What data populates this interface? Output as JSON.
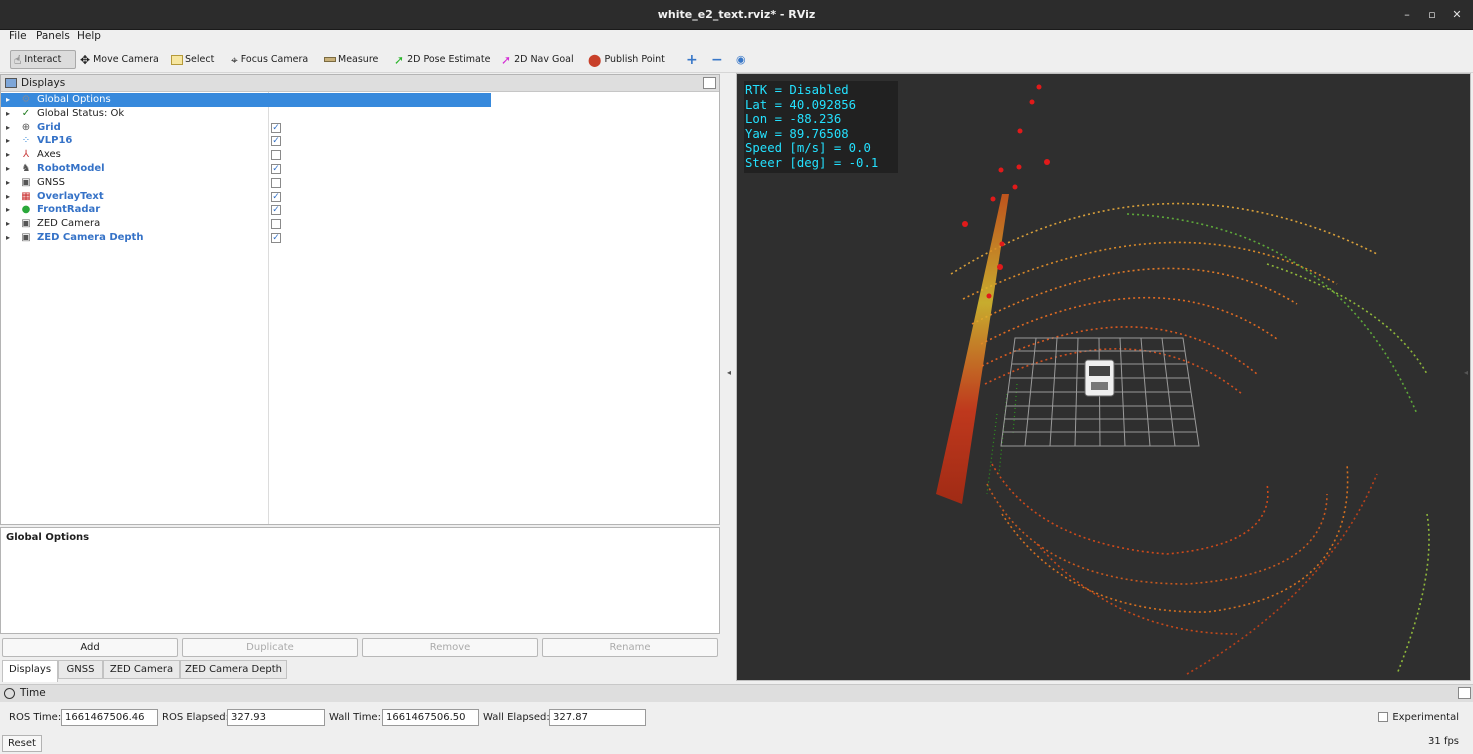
{
  "window": {
    "title": "white_e2_text.rviz* - RViz",
    "min": "–",
    "max": "▫",
    "close": "✕"
  },
  "menu": [
    "File",
    "Panels",
    "Help"
  ],
  "toolbar": {
    "interact": "Interact",
    "move_camera": "Move Camera",
    "select": "Select",
    "focus_camera": "Focus Camera",
    "measure": "Measure",
    "pose_estimate": "2D Pose Estimate",
    "nav_goal": "2D Nav Goal",
    "publish_point": "Publish Point",
    "add_tool": "+",
    "remove_tool": "−",
    "view_menu": "◉"
  },
  "displays_panel": {
    "title": "Displays",
    "items": [
      {
        "label": "Global Options",
        "bold": false,
        "checkbox": null,
        "icon": "gear-icon",
        "glyph": "⚙"
      },
      {
        "label": "Global Status: Ok",
        "bold": false,
        "checkbox": null,
        "icon": "check-icon",
        "glyph": "✓"
      },
      {
        "label": "Grid",
        "bold": true,
        "checkbox": true,
        "icon": "grid-icon",
        "glyph": "⊕"
      },
      {
        "label": "VLP16",
        "bold": true,
        "checkbox": true,
        "icon": "pointcloud-icon",
        "glyph": "⁘"
      },
      {
        "label": "Axes",
        "bold": false,
        "checkbox": false,
        "icon": "axes-icon",
        "glyph": "⅄"
      },
      {
        "label": "RobotModel",
        "bold": true,
        "checkbox": true,
        "icon": "robot-icon",
        "glyph": "♞"
      },
      {
        "label": "GNSS",
        "bold": false,
        "checkbox": false,
        "icon": "image-icon",
        "glyph": "▣"
      },
      {
        "label": "OverlayText",
        "bold": true,
        "checkbox": true,
        "icon": "overlay-icon",
        "glyph": "▦"
      },
      {
        "label": "FrontRadar",
        "bold": true,
        "checkbox": true,
        "icon": "markers-icon",
        "glyph": "●"
      },
      {
        "label": "ZED Camera",
        "bold": false,
        "checkbox": false,
        "icon": "image-icon",
        "glyph": "▣"
      },
      {
        "label": "ZED Camera Depth",
        "bold": true,
        "checkbox": true,
        "icon": "image-icon",
        "glyph": "▣"
      }
    ]
  },
  "properties": {
    "title": "Global Options"
  },
  "buttons": {
    "add": "Add",
    "duplicate": "Duplicate",
    "remove": "Remove",
    "rename": "Rename"
  },
  "tabs": [
    "Displays",
    "GNSS",
    "ZED Camera",
    "ZED Camera Depth"
  ],
  "overlay_text": [
    "RTK = Disabled",
    "Lat = 40.092856",
    "Lon = -88.236",
    "Yaw = 89.76508",
    "Speed [m/s] = 0.0",
    "Steer [deg] = -0.1"
  ],
  "time_panel": {
    "title": "Time",
    "ros_time_label": "ROS Time:",
    "ros_time": "1661467506.46",
    "ros_elapsed_label": "ROS Elapsed:",
    "ros_elapsed": "327.93",
    "wall_time_label": "Wall Time:",
    "wall_time": "1661467506.50",
    "wall_elapsed_label": "Wall Elapsed:",
    "wall_elapsed": "327.87",
    "experimental": "Experimental",
    "reset": "Reset",
    "fps": "31 fps"
  },
  "colors": {
    "selection": "#3789dc",
    "overlay_text": "#24e1ff",
    "viewport_bg": "#2f2f2f",
    "bold_item": "#3572c7"
  }
}
